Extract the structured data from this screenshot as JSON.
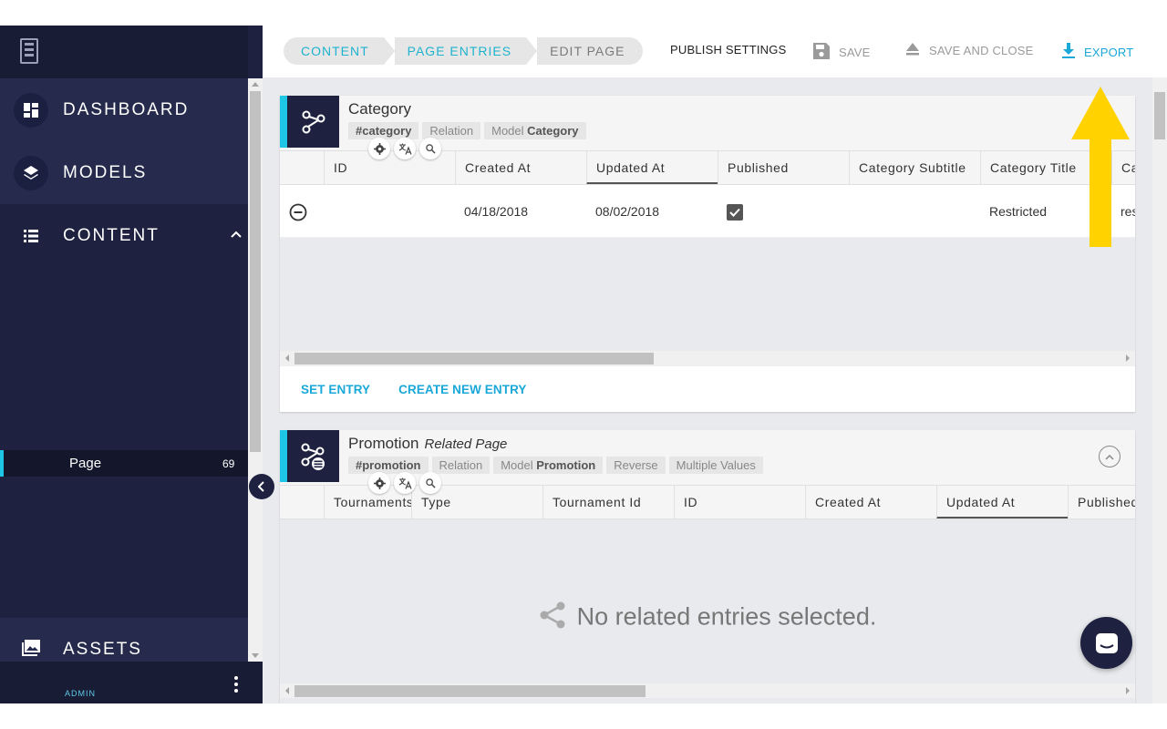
{
  "sidebar": {
    "items": [
      {
        "label": "DASHBOARD",
        "icon": "dashboard-icon"
      },
      {
        "label": "MODELS",
        "icon": "layers-icon"
      },
      {
        "label": "CONTENT",
        "icon": "list-icon"
      }
    ],
    "sub_item": {
      "label": "Page",
      "count": "69"
    },
    "assets": {
      "label": "ASSETS",
      "icon": "image-icon"
    },
    "footer": {
      "user": "ADMIN"
    }
  },
  "topbar": {
    "breadcrumbs": [
      "CONTENT",
      "PAGE ENTRIES",
      "EDIT PAGE"
    ],
    "publish_settings": "PUBLISH SETTINGS",
    "save": "SAVE",
    "save_and_close": "SAVE AND CLOSE",
    "export": "EXPORT"
  },
  "category_card": {
    "title": "Category",
    "tags": {
      "hash": "#category",
      "kind": "Relation",
      "model_prefix": "Model",
      "model": "Category"
    },
    "columns": [
      "ID",
      "Created At",
      "Updated At",
      "Published",
      "Category Subtitle",
      "Category Title",
      "Ca"
    ],
    "row": {
      "id": "",
      "created_at": "04/18/2018",
      "updated_at": "08/02/2018",
      "published": true,
      "subtitle": "",
      "title": "Restricted",
      "extra": "res"
    },
    "actions": {
      "set_entry": "SET ENTRY",
      "create_new": "CREATE NEW ENTRY"
    }
  },
  "promotion_card": {
    "title": "Promotion",
    "subtitle": "Related Page",
    "tags": {
      "hash": "#promotion",
      "kind": "Relation",
      "model_prefix": "Model",
      "model": "Promotion",
      "reverse": "Reverse",
      "multiple": "Multiple Values"
    },
    "columns": [
      "Tournaments",
      "Type",
      "Tournament Id",
      "ID",
      "Created At",
      "Updated At",
      "Published"
    ],
    "empty_message": "No related entries selected."
  },
  "colors": {
    "sidebar_bg": "#1e2240",
    "accent": "#1ec6e6",
    "link": "#1aa8d8",
    "arrow": "#ffd200"
  }
}
